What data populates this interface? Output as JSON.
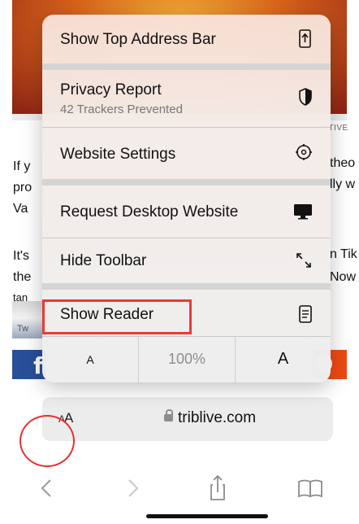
{
  "menu": {
    "items": [
      {
        "label": "Show Top Address Bar",
        "icon": "arrow-up-phone-icon"
      },
      {
        "label": "Privacy Report",
        "sublabel": "42 Trackers Prevented",
        "icon": "shield-icon"
      },
      {
        "label": "Website Settings",
        "icon": "gear-arrow-icon"
      },
      {
        "label": "Request Desktop Website",
        "icon": "monitor-icon"
      },
      {
        "label": "Hide Toolbar",
        "icon": "expand-arrows-icon"
      },
      {
        "label": "Show Reader",
        "icon": "reader-page-icon"
      }
    ],
    "zoom": {
      "smaller": "A",
      "level": "100%",
      "larger": "A"
    }
  },
  "article": {
    "ad_label": "ATIVE",
    "left_fragments": [
      "If y",
      "pro",
      "Va",
      "It's",
      "the",
      "tan"
    ],
    "right_fragments": [
      "theo",
      "lly w",
      "n Tik",
      "Now"
    ],
    "thumb_text": "Tw"
  },
  "address_bar": {
    "aa_small": "A",
    "aa_large": "A",
    "url": "triblive.com"
  },
  "colors": {
    "highlight": "#ea3a35",
    "facebook": "#2a4f9a",
    "reddit": "#ef4a14"
  }
}
